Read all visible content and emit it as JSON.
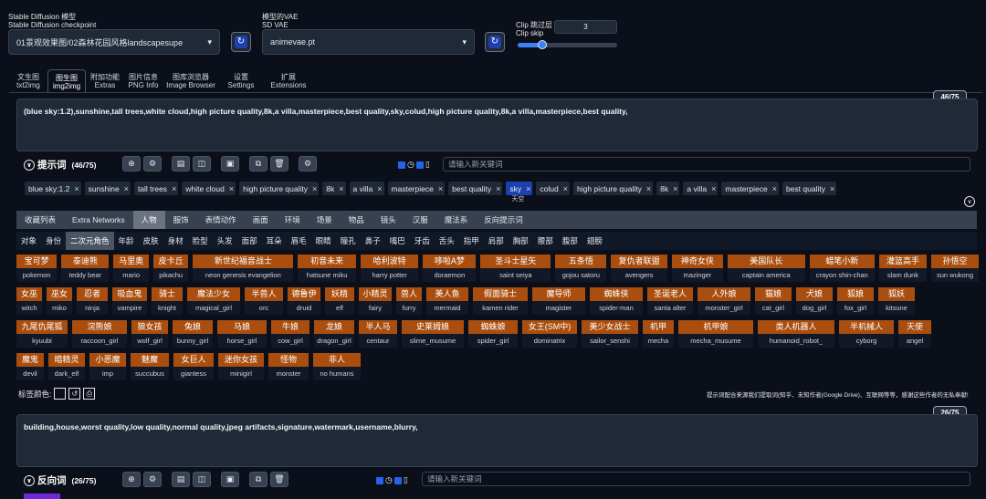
{
  "header": {
    "model_label_1": "Stable Diffusion 模型",
    "model_label_2": "Stable Diffusion checkpoint",
    "model_value": "01景观效果图/02森林花园风格landscapesupe",
    "vae_label_1": "模型的VAE",
    "vae_label_2": "SD VAE",
    "vae_value": "animevae.pt",
    "clip_label_1": "Clip 跳过层",
    "clip_label_2": "Clip skip",
    "clip_value": "3",
    "clip_fraction": 0.25
  },
  "tabs": [
    {
      "zh": "文生图",
      "en": "txt2img"
    },
    {
      "zh": "图生图",
      "en": "img2img"
    },
    {
      "zh": "附加功能",
      "en": "Extras"
    },
    {
      "zh": "图片信息",
      "en": "PNG Info"
    },
    {
      "zh": "图库浏览器",
      "en": "Image Browser"
    },
    {
      "zh": "设置",
      "en": "Settings"
    },
    {
      "zh": "扩展",
      "en": "Extensions"
    }
  ],
  "prompt": {
    "counter": "46/75",
    "text": "(blue sky:1.2),sunshine,tall trees,white cloud,high picture quality,8k,a villa,masterpiece,best quality,sky,colud,high picture quality,8k,a villa,masterpiece,best quality,",
    "section_title": "提示词",
    "section_count": "(46/75)",
    "keyword_placeholder": "请输入新关键词"
  },
  "prompt_tags": [
    "blue sky:1.2",
    "sunshine",
    "tall trees",
    "white cloud",
    "high picture quality",
    "8k",
    "a villa",
    "masterpiece",
    "best quality",
    "sky",
    "colud",
    "high picture quality",
    "8k",
    "a villa",
    "masterpiece",
    "best quality"
  ],
  "tooltip": "天空",
  "categories": [
    "收藏列表",
    "Extra Networks",
    "人物",
    "服饰",
    "表情动作",
    "画面",
    "环境",
    "场景",
    "物品",
    "镜头",
    "汉服",
    "魔法系",
    "反向提示词"
  ],
  "subcategories": [
    "对象",
    "身份",
    "二次元角色",
    "年龄",
    "皮肤",
    "身材",
    "脸型",
    "头发",
    "面部",
    "耳朵",
    "眉毛",
    "眼睛",
    "瞳孔",
    "鼻子",
    "嘴巴",
    "牙齿",
    "舌头",
    "指甲",
    "肩部",
    "胸部",
    "腰部",
    "腹部",
    "翅膀"
  ],
  "grid_rows": [
    [
      {
        "zh": "宝可梦",
        "en": "pokemon"
      },
      {
        "zh": "泰迪熊",
        "en": "teddy bear"
      },
      {
        "zh": "马里奥",
        "en": "mario"
      },
      {
        "zh": "皮卡丘",
        "en": "pikachu"
      },
      {
        "zh": "新世纪福音战士",
        "en": "neon genesis evangelion"
      },
      {
        "zh": "初音未来",
        "en": "hatsune miku"
      },
      {
        "zh": "哈利波特",
        "en": "harry potter"
      },
      {
        "zh": "哆啦A梦",
        "en": "doraemon"
      },
      {
        "zh": "圣斗士星矢",
        "en": "saint seiya"
      },
      {
        "zh": "五条悟",
        "en": "gojou satoru"
      },
      {
        "zh": "复仇者联盟",
        "en": "avengers"
      },
      {
        "zh": "神奇女侠",
        "en": "mazinger"
      },
      {
        "zh": "美国队长",
        "en": "captain america"
      },
      {
        "zh": "蜡笔小新",
        "en": "crayon shin-chan"
      },
      {
        "zh": "灌篮高手",
        "en": "slam dunk"
      },
      {
        "zh": "孙悟空",
        "en": "sun wukong"
      }
    ],
    [
      {
        "zh": "女巫",
        "en": "witch"
      },
      {
        "zh": "巫女",
        "en": "miko"
      },
      {
        "zh": "忍者",
        "en": "ninja"
      },
      {
        "zh": "吸血鬼",
        "en": "vampire"
      },
      {
        "zh": "骑士",
        "en": "knight"
      },
      {
        "zh": "魔法少女",
        "en": "magical_girl"
      },
      {
        "zh": "半兽人",
        "en": "orc"
      },
      {
        "zh": "德鲁伊",
        "en": "druid"
      },
      {
        "zh": "妖精",
        "en": "elf"
      },
      {
        "zh": "小精灵",
        "en": "fairy"
      },
      {
        "zh": "兽人",
        "en": "furry"
      },
      {
        "zh": "美人鱼",
        "en": "mermaid"
      },
      {
        "zh": "假面骑士",
        "en": "kamen rider"
      },
      {
        "zh": "魔导师",
        "en": "magister"
      },
      {
        "zh": "蜘蛛侠",
        "en": "spider-man"
      },
      {
        "zh": "圣诞老人",
        "en": "santa alter"
      },
      {
        "zh": "人外娘",
        "en": "monster_girl"
      },
      {
        "zh": "猫娘",
        "en": "cat_girl"
      },
      {
        "zh": "犬娘",
        "en": "dog_girl"
      },
      {
        "zh": "狐娘",
        "en": "fox_girl"
      },
      {
        "zh": "狐妖",
        "en": "kitsune"
      }
    ],
    [
      {
        "zh": "九尾仇尾狐",
        "en": "kyuubi"
      },
      {
        "zh": "浣熊娘",
        "en": "raccoon_girl"
      },
      {
        "zh": "狼女孩",
        "en": "wolf_girl"
      },
      {
        "zh": "兔娘",
        "en": "bunny_girl"
      },
      {
        "zh": "马娘",
        "en": "horse_girl"
      },
      {
        "zh": "牛娘",
        "en": "cow_girl"
      },
      {
        "zh": "龙娘",
        "en": "dragon_girl"
      },
      {
        "zh": "半人马",
        "en": "centaur"
      },
      {
        "zh": "史莱姆娘",
        "en": "slime_musume"
      },
      {
        "zh": "蜘蛛娘",
        "en": "spider_girl"
      },
      {
        "zh": "女王(SM中)",
        "en": "dominatrix"
      },
      {
        "zh": "美少女战士",
        "en": "sailor_senshi"
      },
      {
        "zh": "机甲",
        "en": "mecha"
      },
      {
        "zh": "机甲娘",
        "en": "mecha_musume"
      },
      {
        "zh": "类人机器人",
        "en": "humanoid_robot_"
      },
      {
        "zh": "半机械人",
        "en": "cyborg"
      },
      {
        "zh": "天使",
        "en": "angel"
      }
    ],
    [
      {
        "zh": "魔鬼",
        "en": "devil"
      },
      {
        "zh": "暗精灵",
        "en": "dark_elf"
      },
      {
        "zh": "小恶魔",
        "en": "imp"
      },
      {
        "zh": "魅魔",
        "en": "succubus"
      },
      {
        "zh": "女巨人",
        "en": "giantess"
      },
      {
        "zh": "迷你女孩",
        "en": "minigirl"
      },
      {
        "zh": "怪物",
        "en": "monster"
      },
      {
        "zh": "非人",
        "en": "no humans"
      }
    ]
  ],
  "tag_color_label": "标签颜色:",
  "hint_text": "提示词配合来源我们提取词(知乎、未知作者(Google Drive)、互联网等等，感谢这些作者的无私奉献!",
  "negative": {
    "counter": "26/75",
    "text": "building,house,worst quality,low quality,normal quality,jpeg artifacts,signature,watermark,username,blurry,",
    "section_title": "反向词",
    "section_count": "(26/75)",
    "keyword_placeholder": "请输入新关键词"
  }
}
